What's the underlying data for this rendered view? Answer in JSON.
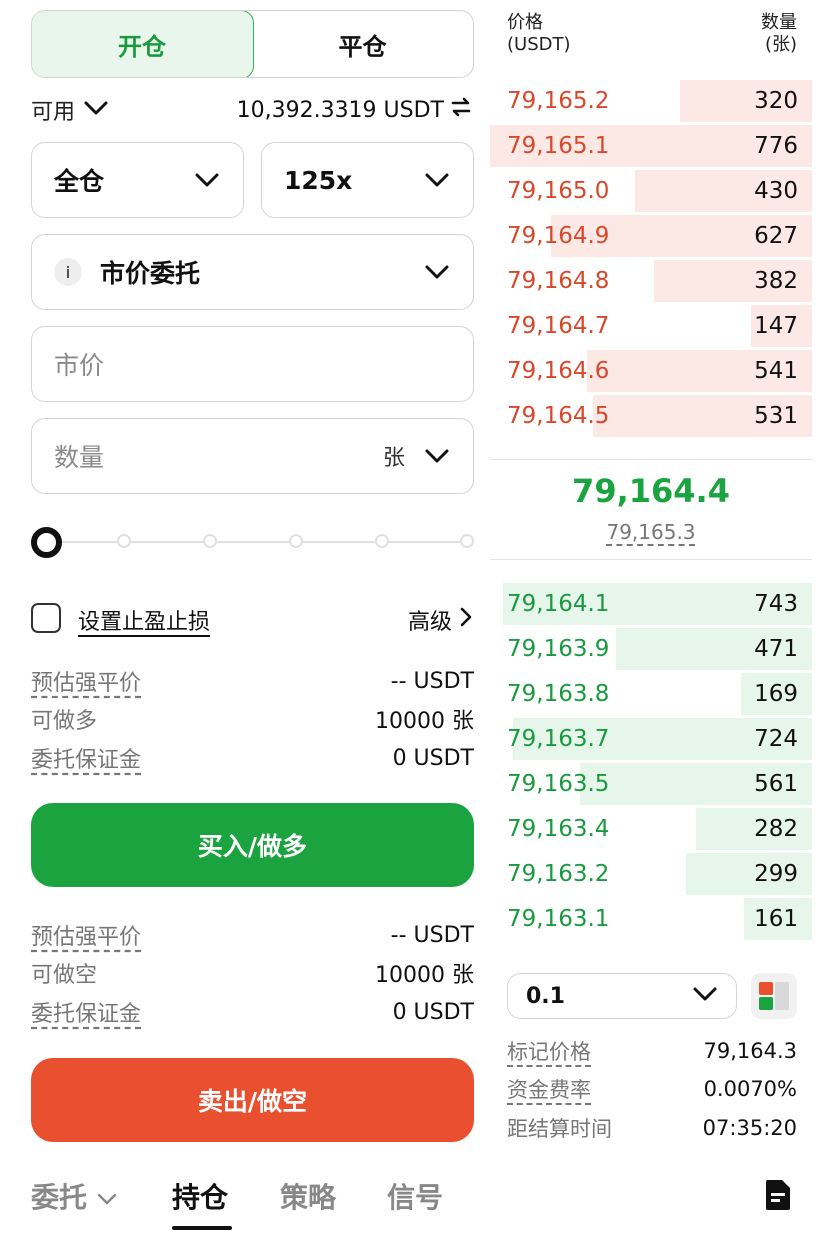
{
  "order_tabs": {
    "open": "开仓",
    "close": "平仓"
  },
  "available": {
    "label": "可用",
    "value": "10,392.3319 USDT"
  },
  "margin_mode": "全仓",
  "leverage": "125x",
  "order_type": {
    "info": "i",
    "label": "市价委托"
  },
  "price_field": {
    "placeholder": "市价"
  },
  "quantity_field": {
    "placeholder": "数量",
    "unit": "张"
  },
  "slider": {
    "level": 0
  },
  "tpsl": {
    "label": "设置止盈止损",
    "advanced": "高级"
  },
  "long_info": [
    {
      "k": "预估强平价",
      "v": "-- USDT"
    },
    {
      "k": "可做多",
      "v": "10000 张"
    },
    {
      "k": "委托保证金",
      "v": "0 USDT"
    }
  ],
  "buy_button": "买入/做多",
  "short_info": [
    {
      "k": "预估强平价",
      "v": "-- USDT"
    },
    {
      "k": "可做空",
      "v": "10000 张"
    },
    {
      "k": "委托保证金",
      "v": "0 USDT"
    }
  ],
  "sell_button": "卖出/做空",
  "bottom_tabs": {
    "orders": "委托",
    "positions": "持仓",
    "strategy": "策略",
    "signals": "信号"
  },
  "orderbook": {
    "header": {
      "price": "价格",
      "price_unit": "(USDT)",
      "qty": "数量",
      "qty_unit": "(张)"
    },
    "asks": [
      {
        "price": "79,165.2",
        "qty": "320",
        "depth": 0.41
      },
      {
        "price": "79,165.1",
        "qty": "776",
        "depth": 1.0
      },
      {
        "price": "79,165.0",
        "qty": "430",
        "depth": 0.55
      },
      {
        "price": "79,164.9",
        "qty": "627",
        "depth": 0.81
      },
      {
        "price": "79,164.8",
        "qty": "382",
        "depth": 0.49
      },
      {
        "price": "79,164.7",
        "qty": "147",
        "depth": 0.19
      },
      {
        "price": "79,164.6",
        "qty": "541",
        "depth": 0.7
      },
      {
        "price": "79,164.5",
        "qty": "531",
        "depth": 0.68
      }
    ],
    "last_price": "79,164.4",
    "mark_price": "79,165.3",
    "bids": [
      {
        "price": "79,164.1",
        "qty": "743",
        "depth": 0.96
      },
      {
        "price": "79,163.9",
        "qty": "471",
        "depth": 0.61
      },
      {
        "price": "79,163.8",
        "qty": "169",
        "depth": 0.22
      },
      {
        "price": "79,163.7",
        "qty": "724",
        "depth": 0.93
      },
      {
        "price": "79,163.5",
        "qty": "561",
        "depth": 0.72
      },
      {
        "price": "79,163.4",
        "qty": "282",
        "depth": 0.36
      },
      {
        "price": "79,163.2",
        "qty": "299",
        "depth": 0.39
      },
      {
        "price": "79,163.1",
        "qty": "161",
        "depth": 0.21
      }
    ],
    "precision": "0.1"
  },
  "stats": [
    {
      "k": "标记价格",
      "v": "79,164.3"
    },
    {
      "k": "资金费率",
      "v": "0.0070%"
    },
    {
      "k": "距结算时间",
      "v": "07:35:20"
    }
  ],
  "colors": {
    "green": "#1aa33f",
    "red": "#e8502f"
  },
  "icons": [
    "chevron-down-icon",
    "swap-icon",
    "info-icon",
    "chevron-right-icon",
    "layout-icon",
    "document-icon"
  ]
}
